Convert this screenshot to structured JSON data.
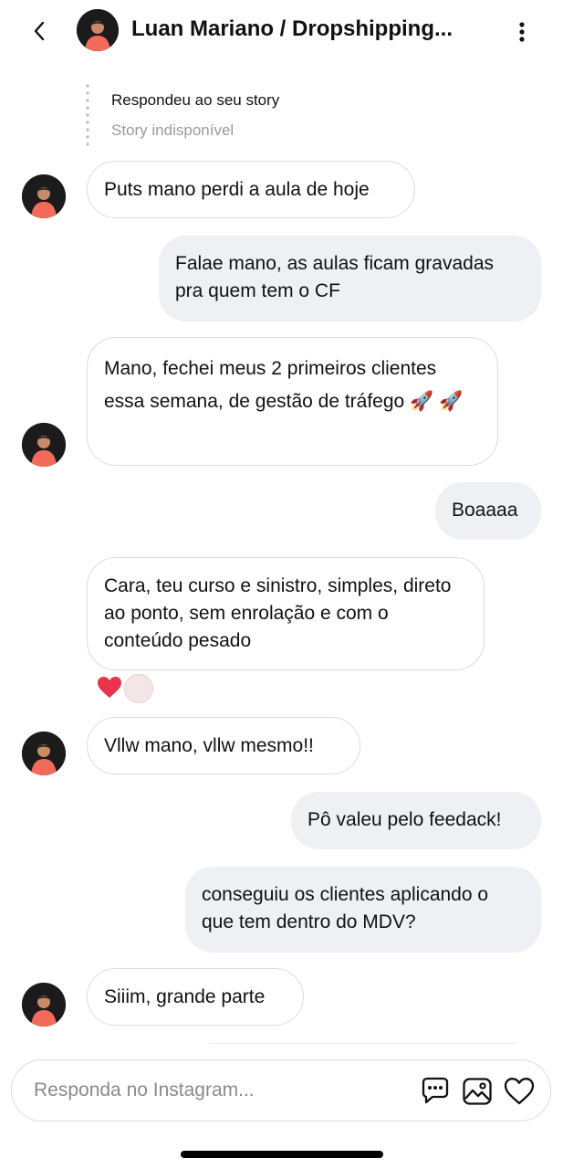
{
  "header": {
    "back_icon": "chevron-left-icon",
    "title": "Luan Mariano / Dropshipping...",
    "menu_icon": "more-vertical-icon"
  },
  "story_reply": {
    "label": "Respondeu ao seu story",
    "status": "Story indisponível"
  },
  "messages": [
    {
      "from": "them",
      "text": "Puts mano perdi a aula de hoje"
    },
    {
      "from": "me",
      "text": "Falae mano, as aulas ficam gravadas pra quem tem o CF"
    },
    {
      "from": "them",
      "text": "Mano, fechei meus 2 primeiros clientes essa semana, de gestão de tráfego 🚀 🚀"
    },
    {
      "from": "me",
      "text": "Boaaaa"
    },
    {
      "from": "them",
      "text": "Cara, teu curso e sinistro, simples, direto ao ponto, sem enrolação e com o conteúdo pesado"
    },
    {
      "from": "them",
      "text": "Vllw mano, vllw mesmo!!"
    },
    {
      "from": "me",
      "text": "Pô valeu pelo feedack!"
    },
    {
      "from": "me",
      "text": "conseguiu os clientes aplicando o que tem dentro do MDV?"
    },
    {
      "from": "them",
      "text": "Siiim, grande parte"
    }
  ],
  "reactions": [
    "heart-icon",
    "emoji-avatar-icon"
  ],
  "composer": {
    "placeholder": "Responda no Instagram...",
    "icons": [
      "chat-bubble-icon",
      "gallery-icon",
      "heart-icon"
    ]
  },
  "colors": {
    "outgoing_bubble": "#eff0f3",
    "incoming_border": "#dcdcdc",
    "avatar_shirt": "#f26a5a",
    "reaction_heart": "#e8344a"
  }
}
